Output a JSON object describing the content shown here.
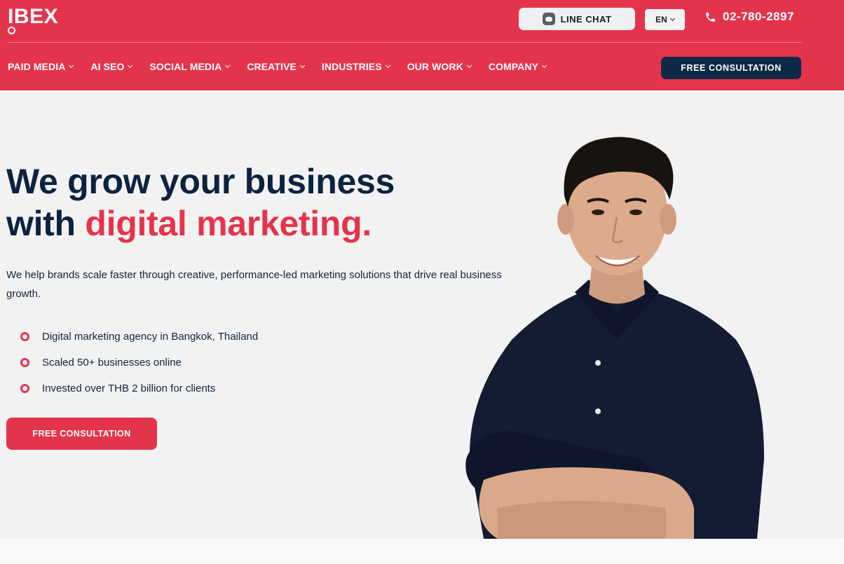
{
  "brand": {
    "logo_text": "IBEX"
  },
  "topbar": {
    "line_chat_label": "LINE CHAT",
    "language": "EN",
    "phone": "02-780-2897"
  },
  "nav": {
    "items": [
      {
        "label": "PAID MEDIA"
      },
      {
        "label": "AI SEO"
      },
      {
        "label": "SOCIAL MEDIA"
      },
      {
        "label": "CREATIVE"
      },
      {
        "label": "INDUSTRIES"
      },
      {
        "label": "OUR WORK"
      },
      {
        "label": "COMPANY"
      }
    ],
    "cta_label": "FREE CONSULTATION"
  },
  "hero": {
    "headline_line1": "We grow your business",
    "headline_line2_prefix": "with ",
    "headline_line2_accent": "digital marketing.",
    "subheadline": "We help brands scale faster through creative, performance-led marketing solutions that drive real business growth.",
    "bullets": [
      "Digital marketing agency in Bangkok, Thailand",
      "Scaled 50+ businesses online",
      "Invested over THB 2 billion for clients"
    ],
    "cta_label": "FREE CONSULTATION"
  },
  "colors": {
    "brand_red": "#e4344c",
    "navy": "#0e2a47",
    "background": "#f3f2f3"
  }
}
